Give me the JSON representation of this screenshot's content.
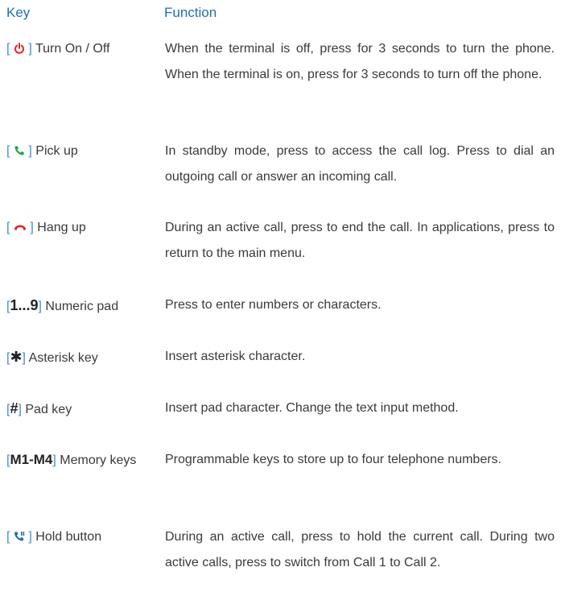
{
  "header": {
    "key": "Key",
    "function": "Function"
  },
  "brackets": {
    "open": "[",
    "close": "]"
  },
  "rows": [
    {
      "icon": "power-icon",
      "icon_color": "#e1262c",
      "label": "Turn On / Off",
      "function": "When the terminal is off, press for 3 seconds to turn the phone. When the terminal is on, press for 3 seconds to turn off the phone."
    },
    {
      "icon": "phone-pickup-icon",
      "icon_color": "#1aa64a",
      "label": "Pick up",
      "function": "In standby mode, press to access the call log. Press to dial an outgoing call or answer an incoming call."
    },
    {
      "icon": "phone-hangup-icon",
      "icon_color": "#e1262c",
      "label": "Hang up",
      "function": "During an active call, press to end the call. In applications, press to return to the main menu."
    },
    {
      "key_text": "1...9",
      "label": "Numeric pad",
      "function": "Press to enter numbers or characters."
    },
    {
      "key_text": "✱",
      "label": "Asterisk key",
      "function": "Insert asterisk character."
    },
    {
      "key_text": "#",
      "label": "Pad key",
      "function": "Insert pad character. Change the text input method."
    },
    {
      "key_text": "M1-M4",
      "label": "Memory keys",
      "function": "Programmable keys to store up to four telephone numbers."
    },
    {
      "icon": "hold-icon",
      "icon_color": "#1f6fb5",
      "label": "Hold button",
      "function": "During an active call, press to hold the current call. During two active calls, press to switch from Call 1 to Call 2."
    }
  ]
}
